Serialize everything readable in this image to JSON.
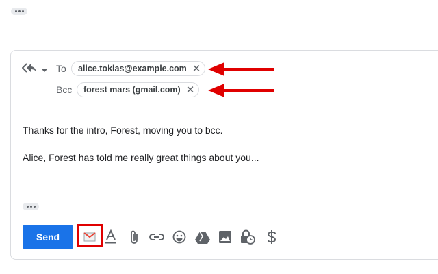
{
  "compose": {
    "to_label": "To",
    "bcc_label": "Bcc",
    "to_recipient": "alice.toklas@example.com",
    "bcc_recipient": "forest mars (gmail.com)",
    "remove_symbol": "✕"
  },
  "message": {
    "line1": "Thanks for the intro, Forest, moving you to bcc.",
    "line2": "Alice, Forest has told me really great things about you..."
  },
  "toolbar": {
    "send_label": "Send",
    "icons": [
      "gmail-icon",
      "format-text-icon",
      "attach-icon",
      "link-icon",
      "emoji-icon",
      "drive-icon",
      "photo-icon",
      "confidential-icon",
      "money-icon"
    ]
  },
  "colors": {
    "accent": "#1a73e8",
    "annotation": "#e00000"
  }
}
